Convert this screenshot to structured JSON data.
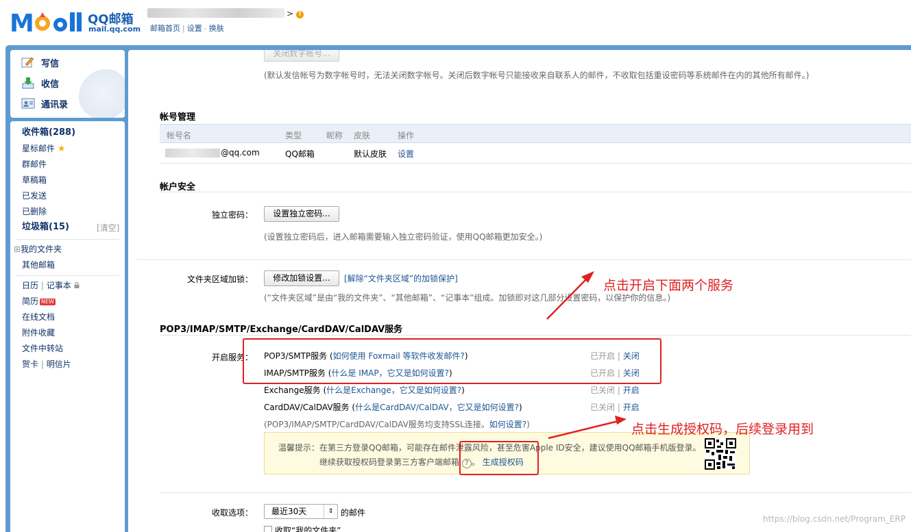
{
  "header": {
    "brand_cn": "QQ邮箱",
    "brand_domain": "mail.qq.com",
    "user_arrow": ">",
    "links": [
      "邮箱首页",
      "设置",
      "换肤"
    ],
    "link_sep": "|",
    "link_sep2": "-"
  },
  "sidebar": {
    "actions": [
      {
        "label": "写信",
        "icon": "compose-icon"
      },
      {
        "label": "收信",
        "icon": "inbox-download-icon"
      },
      {
        "label": "通讯录",
        "icon": "contacts-icon"
      }
    ],
    "inbox": "收件箱(288)",
    "starred": "星标邮件",
    "group": "群邮件",
    "drafts": "草稿箱",
    "sent": "已发送",
    "deleted": "已删除",
    "spam": "垃圾箱(15)",
    "spam_clear": "[清空]",
    "my_folders": "我的文件夹",
    "my_folders_toggle": "⊞",
    "other_mailbox": "其他邮箱",
    "calendar": "日历",
    "notes": "记事本",
    "resume": "简历",
    "resume_badge": "NEW",
    "online_docs": "在线文档",
    "attachments": "附件收藏",
    "file_transfer": "文件中转站",
    "cards": "贺卡",
    "postcards": "明信片",
    "sep": "|"
  },
  "main": {
    "close_digit_btn": "关闭数字帐号...",
    "digit_hint": "(默认发信帐号为数字帐号时，无法关闭数字帐号。关闭后数字帐号只能接收来自联系人的邮件，不收取包括重设密码等系统邮件在内的其他所有邮件。)",
    "account_mgmt": {
      "title": "帐号管理",
      "columns": [
        "帐号名",
        "类型",
        "昵称",
        "皮肤",
        "操作"
      ],
      "row": {
        "account_suffix": "@qq.com",
        "type": "QQ邮箱",
        "nickname": "",
        "skin": "默认皮肤",
        "action": "设置"
      }
    },
    "security": {
      "title": "帐户安全",
      "pwd_label": "独立密码：",
      "pwd_btn": "设置独立密码...",
      "pwd_hint": "(设置独立密码后，进入邮箱需要输入独立密码验证，使用QQ邮箱更加安全。)",
      "lock_label": "文件夹区域加锁：",
      "lock_btn": "修改加锁设置...",
      "lock_link": "[解除“文件夹区域”的加锁保护]",
      "lock_hint": "(“文件夹区域”是由“我的文件夹”、“其他邮箱”、“记事本”组成。加锁即对这几部分设置密码，以保护你的信息。)"
    },
    "services": {
      "title": "POP3/IMAP/SMTP/Exchange/CardDAV/CalDAV服务",
      "open_label": "开启服务：",
      "items": [
        {
          "name": "POP3/SMTP服务",
          "open_paren": "(",
          "help": "如何使用 Foxmail 等软件收发邮件?",
          "close_paren": ")",
          "status": "已开启",
          "sep": "|",
          "action": "关闭"
        },
        {
          "name": "IMAP/SMTP服务",
          "open_paren": "(",
          "help": "什么是 IMAP，它又是如何设置?",
          "close_paren": ")",
          "status": "已开启",
          "sep": "|",
          "action": "关闭"
        },
        {
          "name": "Exchange服务",
          "open_paren": "(",
          "help": "什么是Exchange，它又是如何设置?",
          "close_paren": ")",
          "status": "已关闭",
          "sep": "|",
          "action": "开启"
        },
        {
          "name": "CardDAV/CalDAV服务",
          "open_paren": "(",
          "help": "什么是CardDAV/CalDAV，它又是如何设置?",
          "close_paren": ")",
          "status": "已关闭",
          "sep": "|",
          "action": "开启"
        }
      ],
      "ssl_note_prefix": "(POP3/IMAP/SMTP/CardDAV/CalDAV服务均支持SSL连接。",
      "ssl_note_link": "如何设置?",
      "ssl_note_suffix": ")",
      "tip_line1": "温馨提示：在第三方登录QQ邮箱，可能存在邮件泄露风险，甚至危害Apple ID安全，建议使用QQ邮箱手机版登录。",
      "tip_line2_prefix": "继续获取授权码登录第三方客户端邮箱",
      "tip_help_icon": "?",
      "tip_line2_sep": "。",
      "tip_link": "生成授权码"
    },
    "receive": {
      "label": "收取选项：",
      "select_value": "最近30天",
      "suffix": "的邮件",
      "folder_checkbox": "收取“我的文件夹”"
    }
  },
  "annotations": {
    "a1": "点击开启下面两个服务",
    "a2": "点击生成授权码，后续登录用到",
    "color": "#e02020"
  },
  "watermark": "https://blog.csdn.net/Program_ERP"
}
